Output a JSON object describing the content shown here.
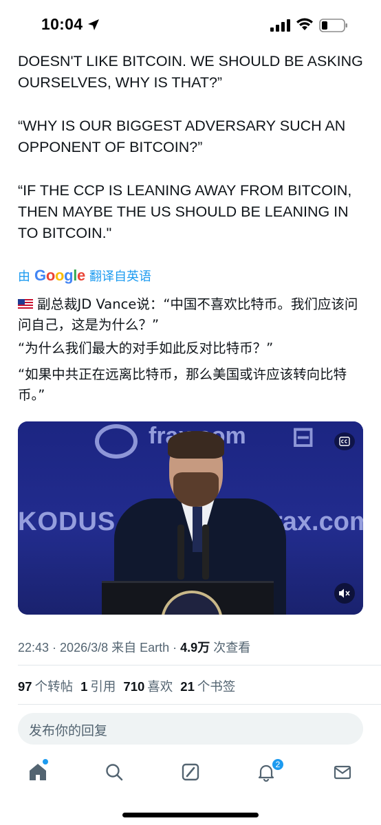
{
  "status_bar": {
    "time": "10:04"
  },
  "tweet": {
    "english_paragraphs": [
      "DOESN'T LIKE BITCOIN. WE SHOULD BE ASKING OURSELVES, WHY IS THAT?”",
      "“WHY IS OUR BIGGEST ADVERSARY SUCH AN OPPONENT OF BITCOIN?”",
      "“IF THE CCP IS LEANING AWAY FROM BITCOIN, THEN MAYBE THE US SHOULD BE LEANING IN TO BITCOIN.\""
    ],
    "translation": {
      "prefix": "由",
      "provider": "Google",
      "suffix": "翻译自英语"
    },
    "chinese_paragraphs": [
      "副总裁JD Vance说：“中国不喜欢比特币。我们应该问问自己，这是为什么？”",
      "“为什么我们最大的对手如此反对比特币？”",
      "“如果中共正在远离比特币，那么美国或许应该转向比特币。”"
    ],
    "media": {
      "background_texts": {
        "frax_top": "frax.com",
        "kodus": "KODUS",
        "frax_mid": "rax.com"
      },
      "cc_icon": "cc-icon",
      "mute_icon": "speaker-muted-icon"
    },
    "meta": {
      "time": "22:43",
      "date": "2026/3/8",
      "source": "来自 Earth",
      "views_count": "4.9万",
      "views_label": "次查看"
    },
    "stats": [
      {
        "count": "97",
        "label": "个转帖"
      },
      {
        "count": "1",
        "label": "引用"
      },
      {
        "count": "710",
        "label": "喜欢"
      },
      {
        "count": "21",
        "label": "个书签"
      }
    ]
  },
  "reply": {
    "placeholder": "发布你的回复"
  },
  "tabbar": {
    "items": [
      "home-icon",
      "search-icon",
      "grok-icon",
      "bell-icon",
      "mail-icon"
    ],
    "notification_badge": "2",
    "accent": "#1d9bf0"
  }
}
